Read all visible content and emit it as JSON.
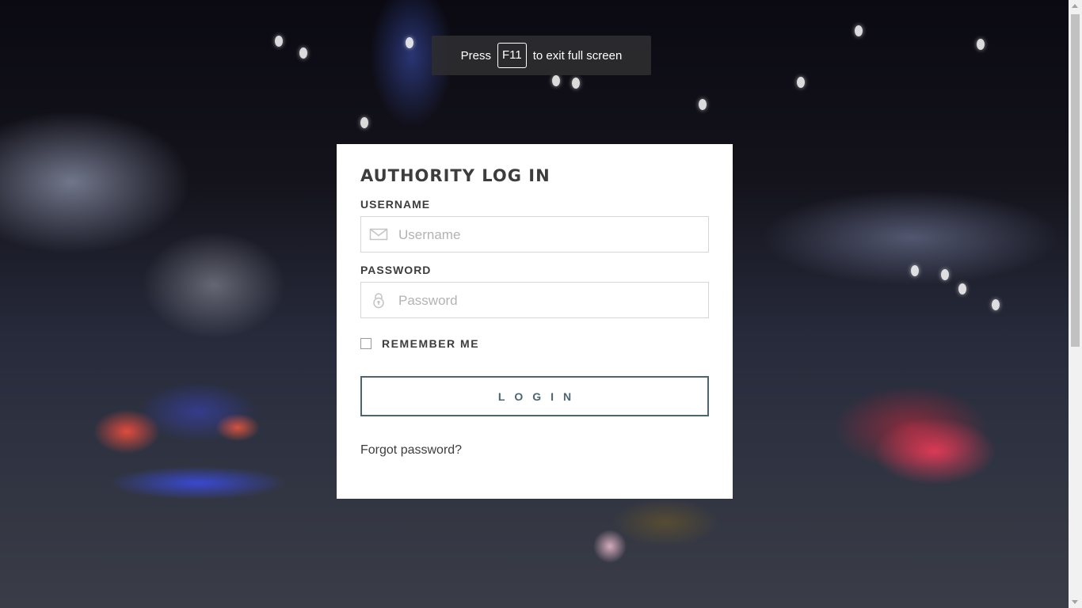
{
  "fullscreen_notice": {
    "before": "Press",
    "key": "F11",
    "after": "to exit full screen"
  },
  "login_form": {
    "title": "AUTHORITY LOG IN",
    "username": {
      "label": "USERNAME",
      "placeholder": "Username",
      "value": "",
      "icon": "envelope-icon"
    },
    "password": {
      "label": "PASSWORD",
      "placeholder": "Password",
      "value": "",
      "icon": "lock-icon"
    },
    "remember_me": {
      "label": "REMEMBER ME",
      "checked": false
    },
    "submit_label": "LOGIN",
    "forgot_link": "Forgot password?"
  },
  "colors": {
    "card_background": "#ffffff",
    "button_border": "#4a6673",
    "text": "#3d3d3d",
    "placeholder": "#b3b3b3"
  }
}
